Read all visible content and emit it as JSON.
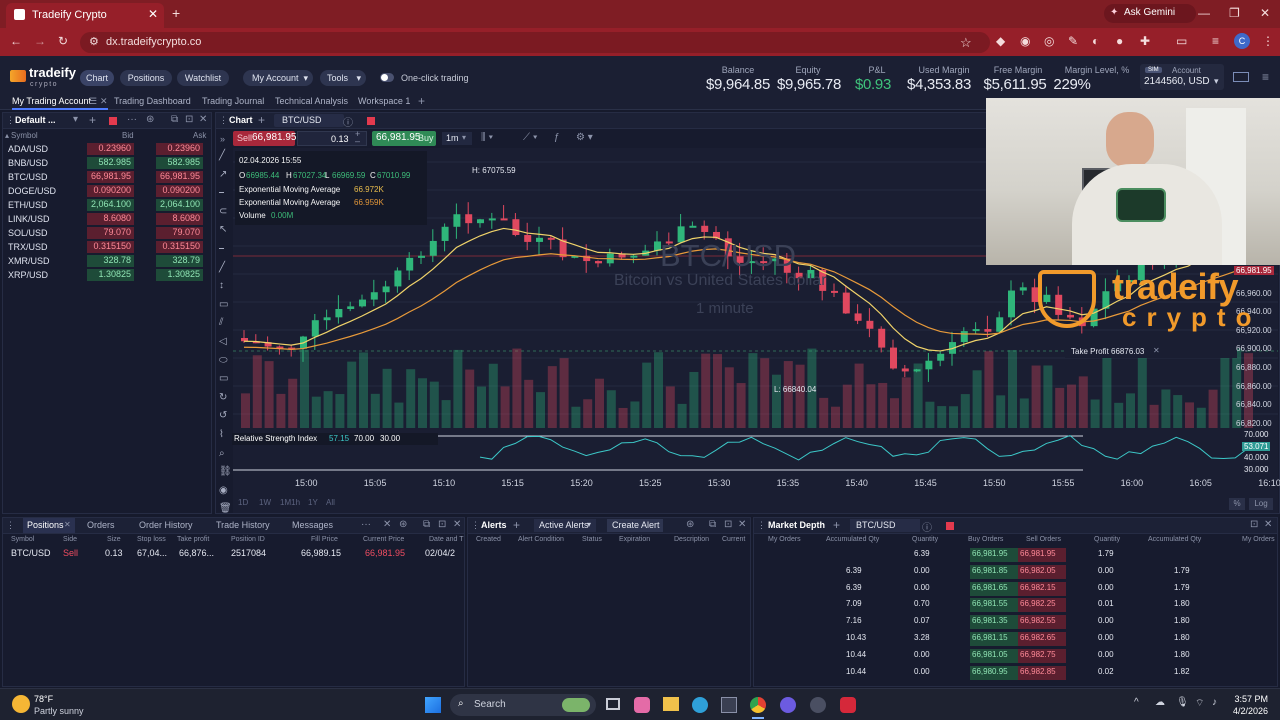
{
  "browser": {
    "tab_title": "Tradeify Crypto",
    "url": "dx.tradeifycrypto.co",
    "ask_gemini": "Ask Gemini"
  },
  "nav": {
    "brand": "tradeify",
    "brand_sub": "crypto",
    "buttons": [
      "Chart",
      "Positions",
      "Watchlist"
    ],
    "my_account": "My Account",
    "tools": "Tools",
    "one_click": "One-click trading"
  },
  "account": {
    "balance_label": "Balance",
    "balance": "$9,964.85",
    "equity_label": "Equity",
    "equity": "$9,965.78",
    "pnl_label": "P&L",
    "pnl": "$0.93",
    "used_margin_label": "Used Margin",
    "used_margin": "$4,353.83",
    "free_margin_label": "Free Margin",
    "free_margin": "$5,611.95",
    "margin_level_label": "Margin Level, %",
    "margin_level": "229%",
    "sim": "SIM",
    "account_label": "Account",
    "account_id": "2144560, USD"
  },
  "workspaces": [
    "My Trading Account",
    "Trading Dashboard",
    "Trading Journal",
    "Technical Analysis",
    "Workspace 1"
  ],
  "watchlist": {
    "title": "Default ...",
    "col_symbol": "Symbol",
    "col_bid": "Bid",
    "col_ask": "Ask",
    "rows": [
      {
        "symbol": "ADA/USD",
        "bid": "0.23960",
        "ask": "0.23960",
        "dir": "red"
      },
      {
        "symbol": "BNB/USD",
        "bid": "582.985",
        "ask": "582.985",
        "dir": "green"
      },
      {
        "symbol": "BTC/USD",
        "bid": "66,981.95",
        "ask": "66,981.95",
        "dir": "red"
      },
      {
        "symbol": "DOGE/USD",
        "bid": "0.090200",
        "ask": "0.090200",
        "dir": "red"
      },
      {
        "symbol": "ETH/USD",
        "bid": "2,064.100",
        "ask": "2,064.100",
        "dir": "green"
      },
      {
        "symbol": "LINK/USD",
        "bid": "8.6080",
        "ask": "8.6080",
        "dir": "red"
      },
      {
        "symbol": "SOL/USD",
        "bid": "79.070",
        "ask": "79.070",
        "dir": "red"
      },
      {
        "symbol": "TRX/USD",
        "bid": "0.315150",
        "ask": "0.315150",
        "dir": "red"
      },
      {
        "symbol": "XMR/USD",
        "bid": "328.78",
        "ask": "328.79",
        "dir": "green"
      },
      {
        "symbol": "XRP/USD",
        "bid": "1.30825",
        "ask": "1.30825",
        "dir": "green"
      }
    ]
  },
  "chart_panel": {
    "title": "Chart",
    "symbol": "BTC/USD",
    "sell_label": "Sell",
    "sell_price": "66,981.95",
    "qty": "0.13",
    "buy_price": "66,981.95",
    "buy_label": "Buy",
    "timeframe": "1m",
    "info_date": "02.04.2026 15:55",
    "ohlc": {
      "o_label": "O",
      "o": "66985.44",
      "h_label": "H",
      "h": "67027.34",
      "l_label": "L",
      "l": "66969.59",
      "c_label": "C",
      "c": "67010.99"
    },
    "ema1_label": "Exponential Moving Average",
    "ema1": "66.972K",
    "ema2_label": "Exponential Moving Average",
    "ema2": "66.959K",
    "vol_label": "Volume",
    "vol": "0.00M",
    "high_label": "H:  67075.59",
    "low_label": "L:  66840.04",
    "wm_symbol": "BTC/USD",
    "wm_desc": "Bitcoin vs United States dollar",
    "wm_tf": "1 minute",
    "tp_label": "Take Profit 66876.03",
    "rsi_label": "Relative Strength Index",
    "rsi_val": "57.15",
    "rsi_a": "70.00",
    "rsi_b": "30.00",
    "price_ticks": [
      "66,981.95",
      "66,960.00",
      "66,940.00",
      "66,920.00",
      "66,900.00",
      "66,880.00",
      "66,860.00",
      "66,840.00",
      "66,820.00"
    ],
    "rsi_ticks": [
      "70.000",
      "53.071",
      "40.000",
      "30.000"
    ],
    "time_ticks": [
      "15:00",
      "15:05",
      "15:10",
      "15:15",
      "15:20",
      "15:25",
      "15:30",
      "15:35",
      "15:40",
      "15:45",
      "15:50",
      "15:55",
      "16:00",
      "16:05",
      "16:10"
    ],
    "ranges": [
      "1D",
      "1W",
      "1M1h",
      "1Y",
      "All"
    ]
  },
  "positions": {
    "tabs": [
      "Positions",
      "Orders",
      "Order History",
      "Trade History",
      "Messages"
    ],
    "cols": [
      "Symbol",
      "Side",
      "Size",
      "Stop loss",
      "Take profit",
      "Position ID",
      "Fill Price",
      "Current Price",
      "Date and T"
    ],
    "row": [
      "BTC/USD",
      "Sell",
      "0.13",
      "67,04...",
      "66,876...",
      "2517084",
      "66,989.15",
      "66,981.95",
      "02/04/2"
    ]
  },
  "alerts": {
    "title": "Alerts",
    "active": "Active Alerts",
    "create": "Create Alert",
    "cols": [
      "Created",
      "Alert Condition",
      "Status",
      "Expiration",
      "Description",
      "Current"
    ]
  },
  "depth": {
    "title": "Market Depth",
    "symbol": "BTC/USD",
    "cols": [
      "My Orders",
      "Accumulated Qty",
      "Quantity",
      "Buy Orders",
      "Sell Orders",
      "Quantity",
      "Accumulated Qty",
      "My Orders"
    ],
    "rows": [
      [
        "",
        "",
        "6.39",
        "66,981.95",
        "66,981.95",
        "1.79",
        "",
        ""
      ],
      [
        "",
        "6.39",
        "0.00",
        "66,981.85",
        "66,982.05",
        "0.00",
        "1.79",
        ""
      ],
      [
        "",
        "6.39",
        "0.00",
        "66,981.65",
        "66,982.15",
        "0.00",
        "1.79",
        ""
      ],
      [
        "",
        "7.09",
        "0.70",
        "66,981.55",
        "66,982.25",
        "0.01",
        "1.80",
        ""
      ],
      [
        "",
        "7.16",
        "0.07",
        "66,981.35",
        "66,982.55",
        "0.00",
        "1.80",
        ""
      ],
      [
        "",
        "10.43",
        "3.28",
        "66,981.15",
        "66,982.65",
        "0.00",
        "1.80",
        ""
      ],
      [
        "",
        "10.44",
        "0.00",
        "66,981.05",
        "66,982.75",
        "0.00",
        "1.80",
        ""
      ],
      [
        "",
        "10.44",
        "0.00",
        "66,980.95",
        "66,982.85",
        "0.02",
        "1.82",
        ""
      ]
    ]
  },
  "taskbar": {
    "temp": "78°F",
    "weather": "Partly sunny",
    "search": "Search",
    "time": "3:57 PM",
    "date": "4/2/2026"
  },
  "overlay": {
    "logo1": "tradeify",
    "logo2": "crypto"
  },
  "colors": {
    "up": "#2fb67a",
    "down": "#e0485f",
    "bg": "#1a1e32",
    "accent": "#3a4366"
  }
}
